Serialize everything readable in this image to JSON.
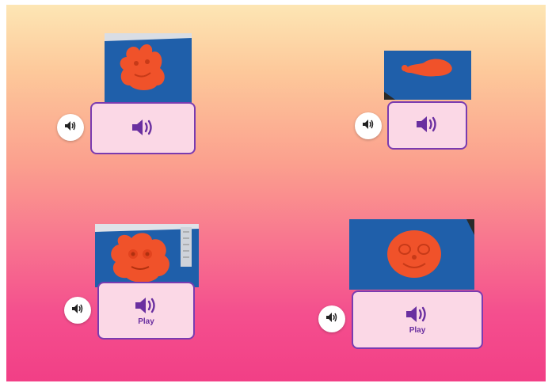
{
  "colors": {
    "accent": "#7a3bb0",
    "card_bg": "#fbd8e6",
    "photo_bg": "#1f5faa",
    "playdough": "#f0522a"
  },
  "items": [
    {
      "photo": "orange-playdough-creature-photo",
      "label": ""
    },
    {
      "photo": "orange-playdough-snake-photo",
      "label": ""
    },
    {
      "photo": "orange-playdough-face-with-ruler-photo",
      "label": "Play"
    },
    {
      "photo": "orange-playdough-round-face-photo",
      "label": "Play"
    }
  ],
  "icons": {
    "audio": "speaker-icon"
  }
}
